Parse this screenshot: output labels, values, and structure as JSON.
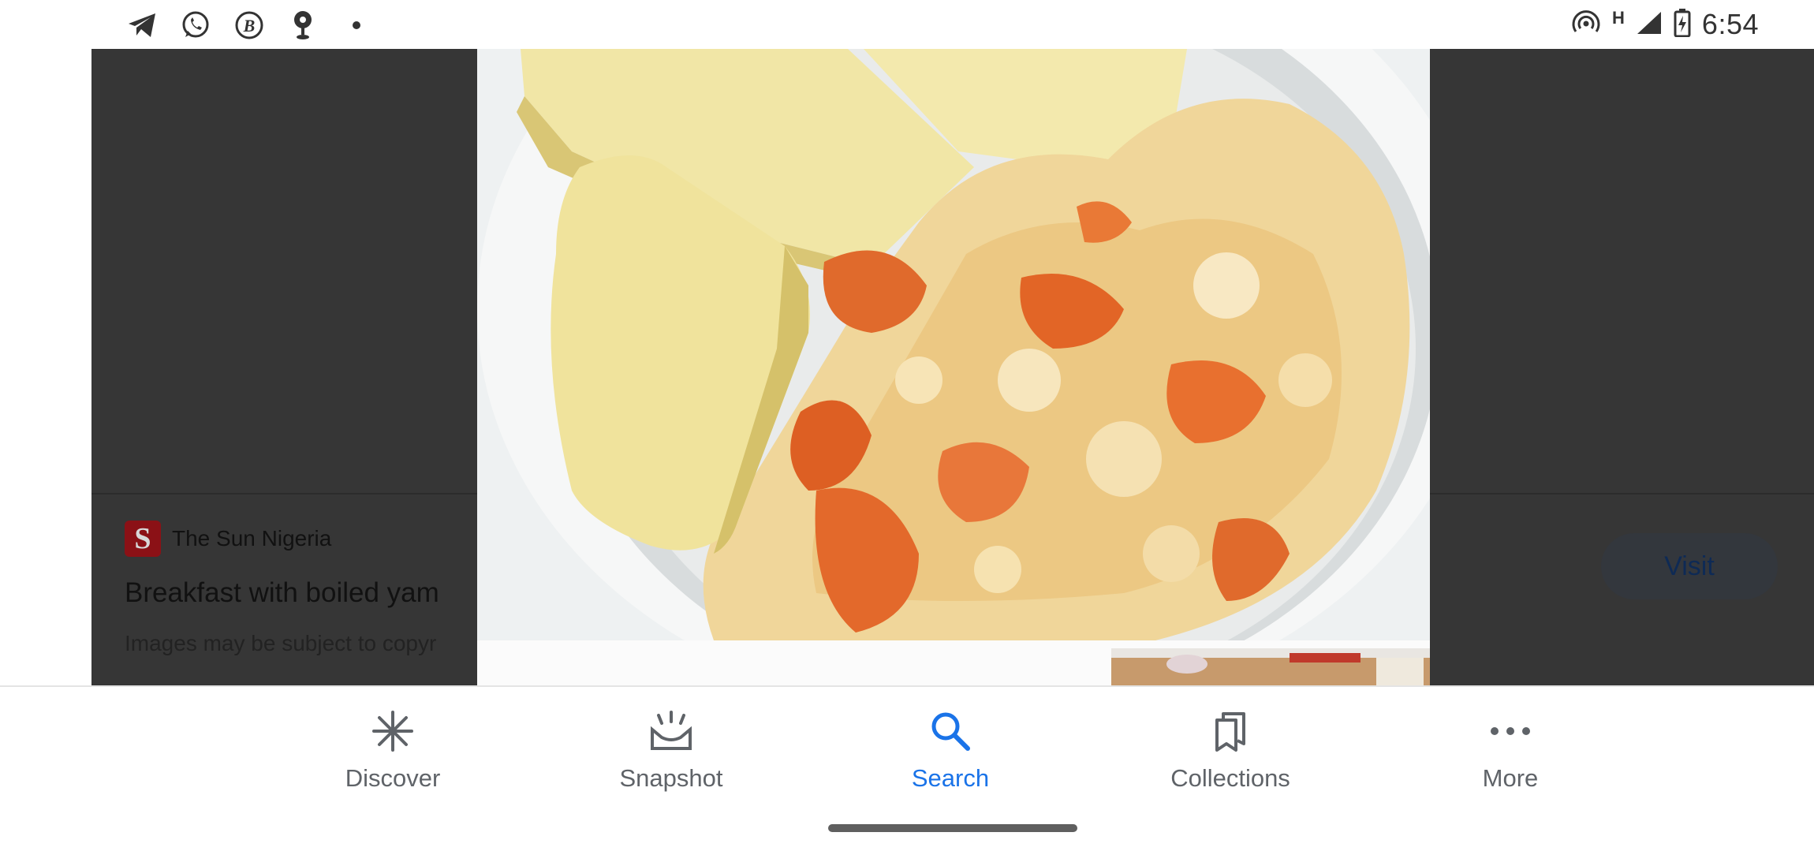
{
  "status_bar": {
    "time": "6:54",
    "network_label": "H",
    "left_icons": [
      "telegram-icon",
      "whatsapp-icon",
      "b-app-icon",
      "location-pin-icon",
      "dot-icon"
    ],
    "right_icons": [
      "hotspot-icon",
      "signal-icon",
      "battery-charging-icon"
    ]
  },
  "result": {
    "source_name": "The Sun Nigeria",
    "source_logo_letter": "S",
    "title": "Breakfast with boiled yam",
    "note": "Images may be subject to copyr",
    "visit_label": "Visit"
  },
  "bottom_nav": {
    "active": "Search",
    "items": [
      {
        "label": "Discover",
        "icon": "asterisk-icon"
      },
      {
        "label": "Snapshot",
        "icon": "snapshot-icon"
      },
      {
        "label": "Search",
        "icon": "search-icon"
      },
      {
        "label": "Collections",
        "icon": "collections-icon"
      },
      {
        "label": "More",
        "icon": "more-dots-icon"
      }
    ]
  },
  "colors": {
    "accent": "#1a73e8",
    "nav_inactive": "#5f6368",
    "viewer_bg": "#363636"
  }
}
